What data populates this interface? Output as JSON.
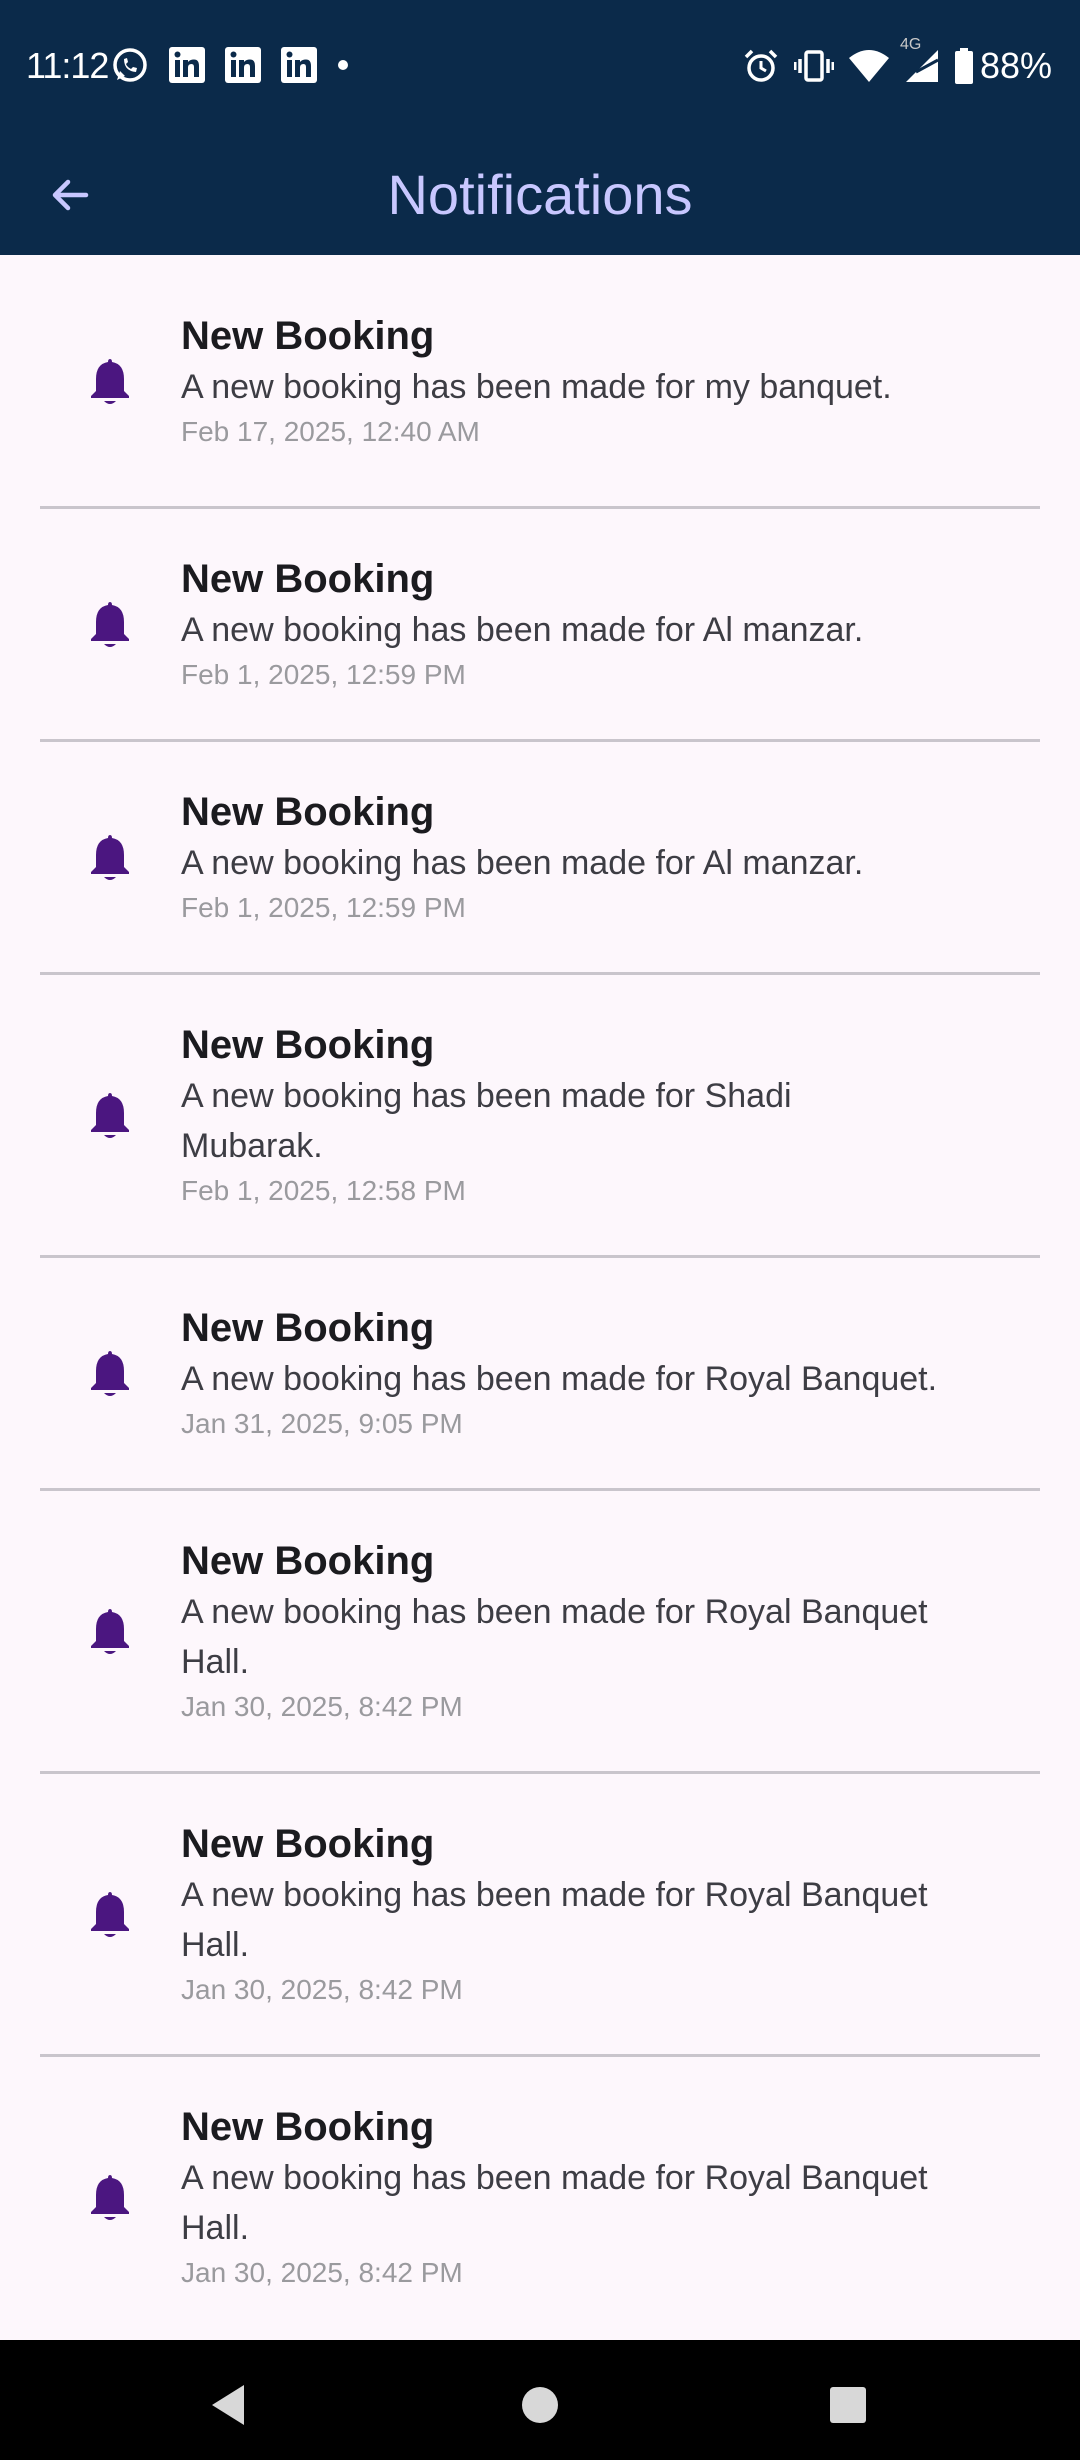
{
  "status_bar": {
    "time": "11:12",
    "battery": "88%",
    "network_label": "4G",
    "left_icons": [
      "whatsapp-icon",
      "linkedin-icon",
      "linkedin-icon",
      "linkedin-icon",
      "dot-icon"
    ],
    "right_icons": [
      "alarm-icon",
      "vibrate-icon",
      "wifi-icon",
      "signal-icon",
      "battery-icon"
    ]
  },
  "app_bar": {
    "title": "Notifications",
    "back_icon": "arrow-left-icon",
    "background": "#0b2a4a",
    "title_color": "#c8c7ff"
  },
  "notifications": [
    {
      "title": "New Booking",
      "body": "A new booking has been made for my banquet.",
      "date": "Feb 17, 2025, 12:40 AM",
      "icon": "bell-icon"
    },
    {
      "title": "New Booking",
      "body": "A new booking has been made for Al manzar.",
      "date": "Feb 1, 2025, 12:59 PM",
      "icon": "bell-icon"
    },
    {
      "title": "New Booking",
      "body": "A new booking has been made for Al manzar.",
      "date": "Feb 1, 2025, 12:59 PM",
      "icon": "bell-icon"
    },
    {
      "title": "New Booking",
      "body": "A new booking has been made for Shadi Mubarak.",
      "date": "Feb 1, 2025, 12:58 PM",
      "icon": "bell-icon"
    },
    {
      "title": "New Booking",
      "body": "A new booking has been made for Royal Banquet.",
      "date": "Jan 31, 2025, 9:05 PM",
      "icon": "bell-icon"
    },
    {
      "title": "New Booking",
      "body": "A new booking has been made for Royal Banquet Hall.",
      "date": "Jan 30, 2025, 8:42 PM",
      "icon": "bell-icon"
    },
    {
      "title": "New Booking",
      "body": "A new booking has been made for Royal Banquet Hall.",
      "date": "Jan 30, 2025, 8:42 PM",
      "icon": "bell-icon"
    },
    {
      "title": "New Booking",
      "body": "A new booking has been made for Royal Banquet Hall.",
      "date": "Jan 30, 2025, 8:42 PM",
      "icon": "bell-icon"
    }
  ],
  "colors": {
    "bell": "#4b1680",
    "page_background": "#fdf7fc",
    "divider": "#c9c5cc"
  },
  "nav_bar": {
    "buttons": [
      "back-triangle-icon",
      "home-circle-icon",
      "recents-square-icon"
    ]
  }
}
